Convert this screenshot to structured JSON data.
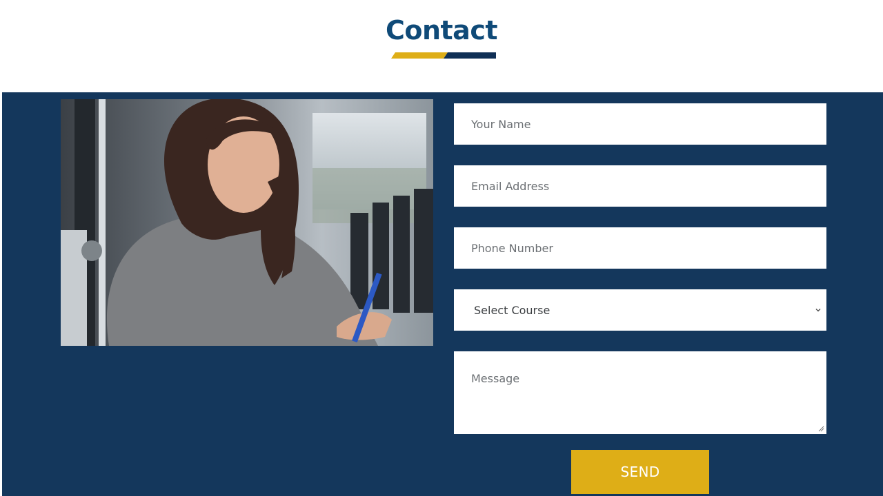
{
  "page": {
    "title": "Contact",
    "accent_color": "#deae17",
    "brand_color": "#0f4a78",
    "panel_color": "#14375c"
  },
  "contact_form": {
    "name_placeholder": "Your Name",
    "email_placeholder": "Email Address",
    "phone_placeholder": "Phone Number",
    "course_select": {
      "selected": "Select Course",
      "icon": "chevron-down-icon"
    },
    "message_placeholder": "Message",
    "send_label": "SEND"
  },
  "photo": {
    "description_icon": "student-photo"
  }
}
